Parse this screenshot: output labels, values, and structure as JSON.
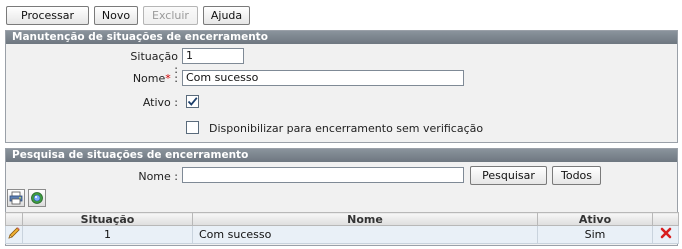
{
  "toolbar": {
    "processar": "Processar",
    "novo": "Novo",
    "excluir": "Excluir",
    "ajuda": "Ajuda"
  },
  "manutencao": {
    "title": "Manutenção de situações de encerramento",
    "situacao_label": "Situação :",
    "situacao_value": "1",
    "nome_label": "Nome",
    "nome_required": "*",
    "nome_sep": ":",
    "nome_value": "Com sucesso",
    "ativo_label": "Ativo :",
    "ativo_checked": true,
    "disponibilizar_label": "Disponibilizar para encerramento sem verificação",
    "disponibilizar_checked": false
  },
  "pesquisa": {
    "title": "Pesquisa de situações de encerramento",
    "nome_label": "Nome :",
    "nome_value": "",
    "pesquisar": "Pesquisar",
    "todos": "Todos"
  },
  "table": {
    "columns": [
      "",
      "Situação",
      "Nome",
      "Ativo",
      ""
    ],
    "rows": [
      {
        "situacao": "1",
        "nome": "Com sucesso",
        "ativo": "Sim"
      }
    ]
  },
  "icons": {
    "print": "printer-icon",
    "refresh": "refresh-icon",
    "edit": "pencil-icon",
    "delete": "delete-x-icon"
  },
  "colors": {
    "panel_header": "#7a838c",
    "row_bg": "#e9f0f7",
    "delete_red": "#d81e1e",
    "required": "#d40000"
  }
}
